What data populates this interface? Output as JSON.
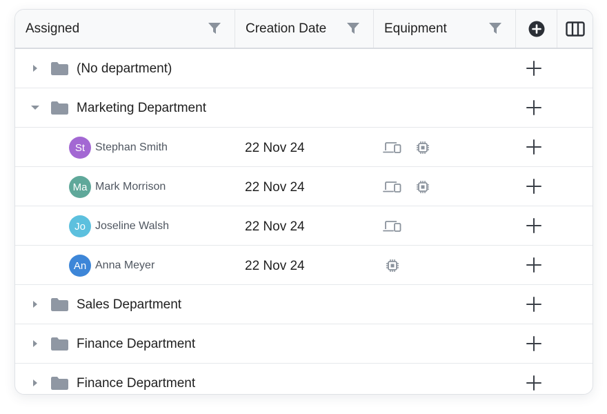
{
  "header": {
    "assigned_label": "Assigned",
    "date_label": "Creation Date",
    "equipment_label": "Equipment",
    "icons": [
      "filter-icon",
      "add-circle-icon",
      "columns-icon"
    ]
  },
  "rows": [
    {
      "type": "department",
      "label": "(No department)",
      "expanded": false
    },
    {
      "type": "department",
      "label": "Marketing Department",
      "expanded": true
    },
    {
      "type": "person",
      "initials": "St",
      "name": "Stephan Smith",
      "date": "22 Nov 24",
      "avatar_color": "#a368d3",
      "equipment": [
        "devices-icon",
        "chip-icon"
      ]
    },
    {
      "type": "person",
      "initials": "Ma",
      "name": "Mark Morrison",
      "date": "22 Nov 24",
      "avatar_color": "#5fa89a",
      "equipment": [
        "devices-icon",
        "chip-icon"
      ]
    },
    {
      "type": "person",
      "initials": "Jo",
      "name": "Joseline Walsh",
      "date": "22 Nov 24",
      "avatar_color": "#5cc0de",
      "equipment": [
        "devices-icon"
      ]
    },
    {
      "type": "person",
      "initials": "An",
      "name": "Anna Meyer",
      "date": "22 Nov 24",
      "avatar_color": "#3d86d8",
      "equipment": [
        "chip-icon"
      ]
    },
    {
      "type": "department",
      "label": "Sales Department",
      "expanded": false
    },
    {
      "type": "department",
      "label": "Finance Department",
      "expanded": false
    },
    {
      "type": "department",
      "label": "Finance Department",
      "expanded": false
    }
  ],
  "colors": {
    "icon_gray": "#8a929c",
    "header_bg": "#f8f9fa",
    "border": "#e6e8eb"
  }
}
